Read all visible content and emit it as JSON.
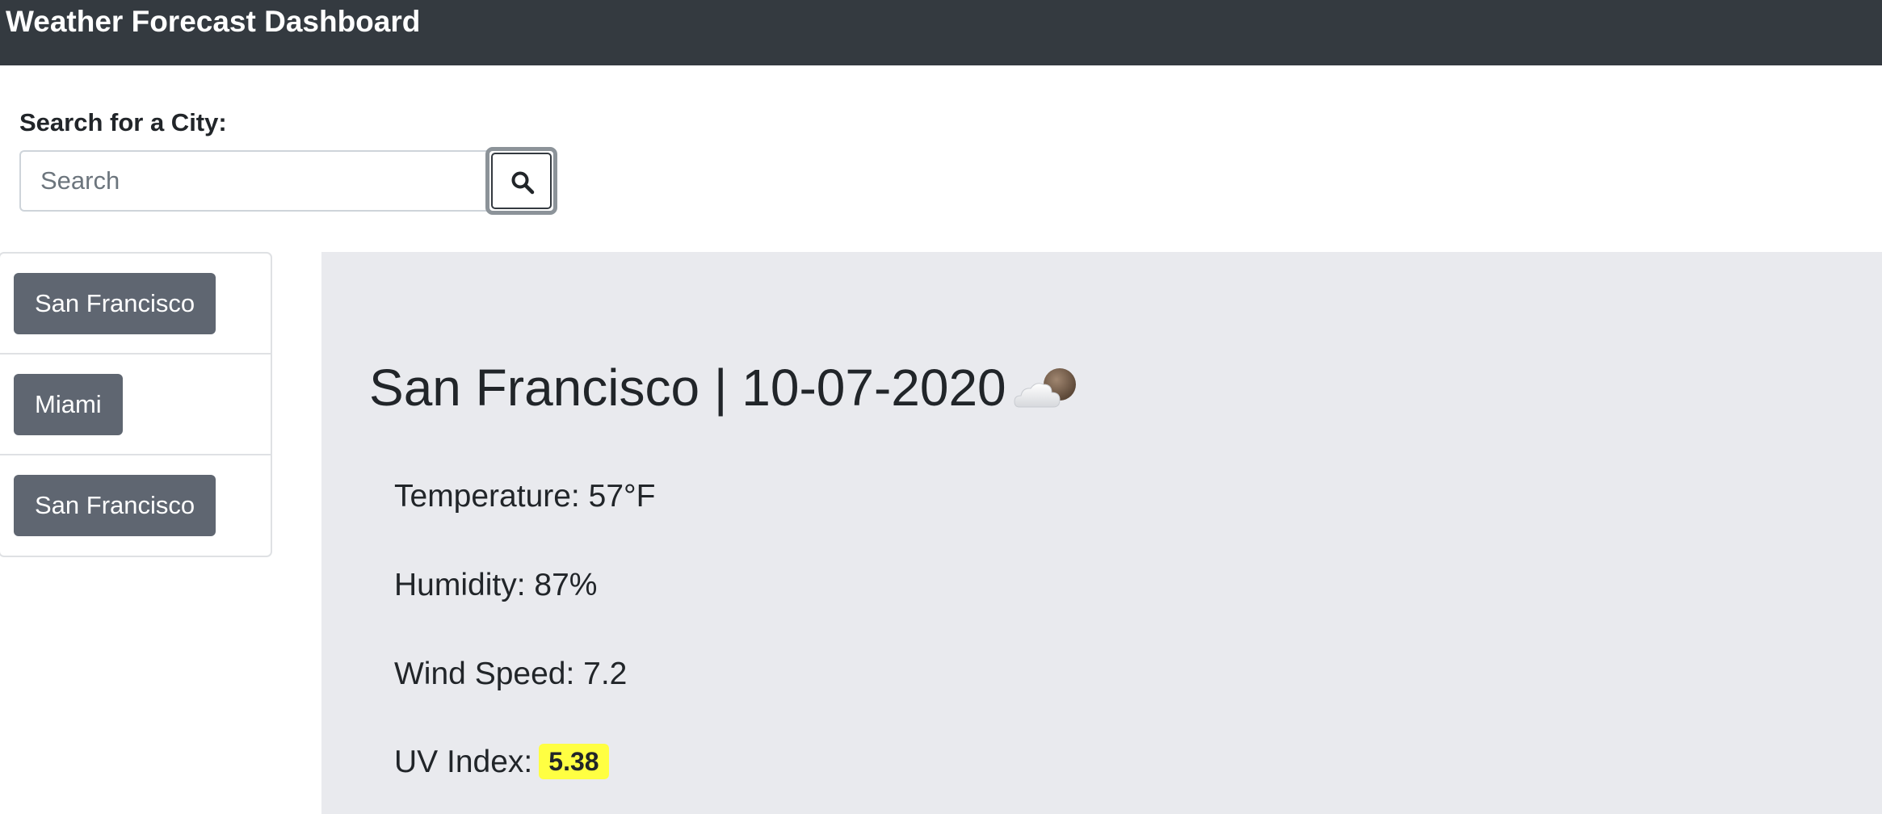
{
  "navbar": {
    "title": "Weather Forecast Dashboard"
  },
  "search": {
    "label": "Search for a City:",
    "placeholder": "Search",
    "value": "",
    "button_icon": "search-icon"
  },
  "history": {
    "items": [
      {
        "label": "San Francisco"
      },
      {
        "label": "Miami"
      },
      {
        "label": "San Francisco"
      }
    ]
  },
  "current": {
    "heading": "San Francisco | 10-07-2020",
    "weather_icon": "cloud-with-moon-icon",
    "temperature_label": "Temperature:",
    "temperature_value": "57°F",
    "humidity_label": "Humidity:",
    "humidity_value": "87%",
    "wind_label": "Wind Speed:",
    "wind_value": "7.2",
    "uv_label": "UV Index:",
    "uv_value": "5.38",
    "uv_color": "#ffff42"
  },
  "colors": {
    "navbar_bg": "#343a40",
    "history_button_bg": "#5f6671",
    "panel_bg": "#e9eaee"
  }
}
